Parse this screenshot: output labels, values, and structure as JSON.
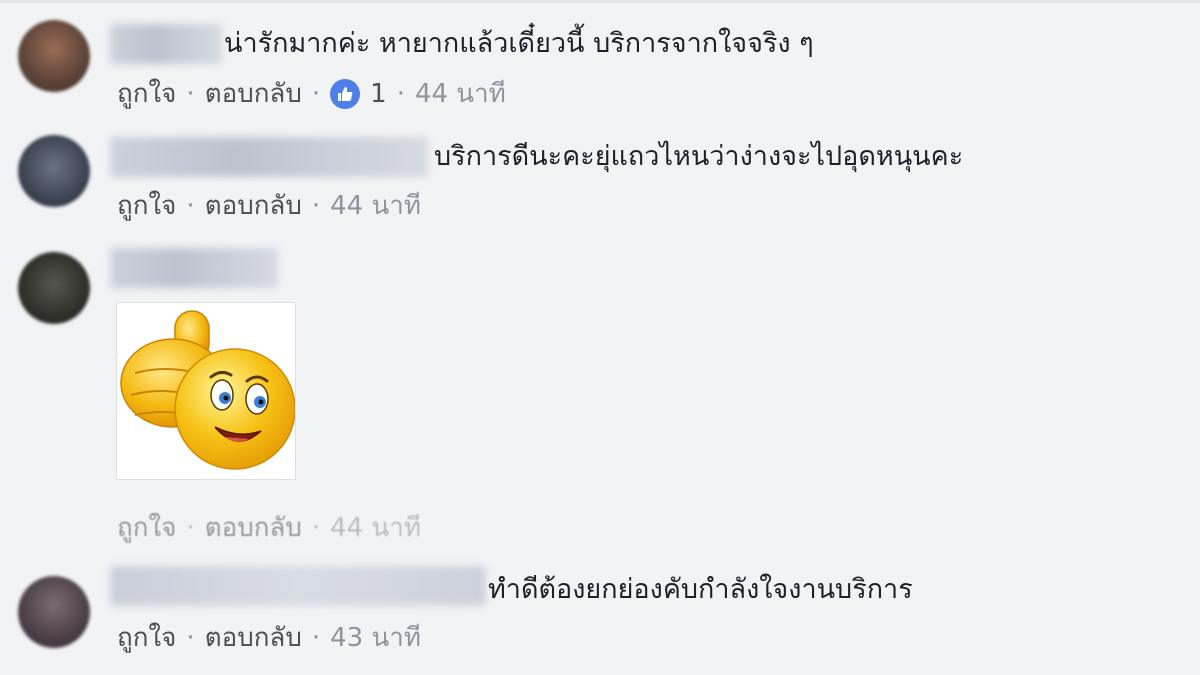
{
  "comments": [
    {
      "text": "น่ารักมากค่ะ หายากแล้วเดี๋ยวนี้ บริการจากใจจริง ๆ",
      "like_label": "ถูกใจ",
      "reply_label": "ตอบกลับ",
      "reaction_count": "1",
      "time": "44 นาที"
    },
    {
      "text": "บริการดีนะคะยุ่แถวไหนว่าง่างจะไปอุดหนุนคะ",
      "like_label": "ถูกใจ",
      "reply_label": "ตอบกลับ",
      "time": "44 นาที"
    },
    {
      "sticker": "thumbs-up-smiley",
      "like_label": "ถูกใจ",
      "reply_label": "ตอบกลับ",
      "time": "44 นาที"
    },
    {
      "text": "ทำดีต้องยกย่องคับกำลังใจงานบริการ",
      "like_label": "ถูกใจ",
      "reply_label": "ตอบกลับ",
      "time": "43 นาที"
    }
  ],
  "separator": "·",
  "colors": {
    "background": "#f2f3f5",
    "text": "#1d2129",
    "meta": "#4b4f56",
    "time": "#90949c",
    "like_badge": "#4f7fe8"
  }
}
